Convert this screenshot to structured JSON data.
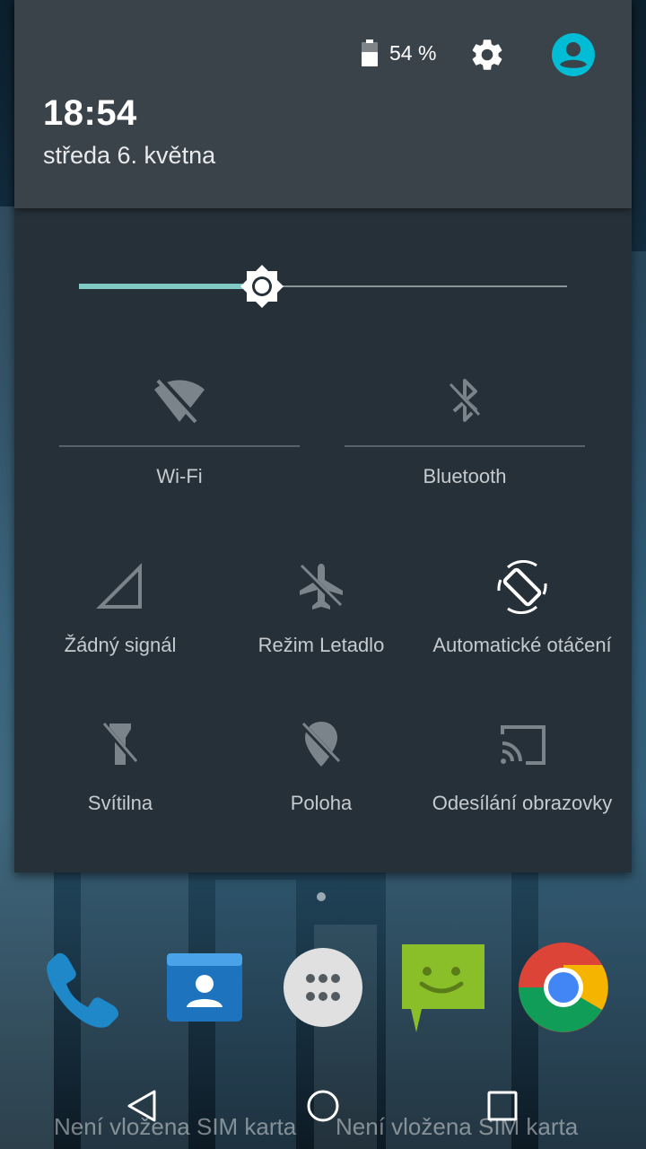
{
  "status": {
    "battery_percent": "54 %",
    "clock": "18:54",
    "date": "středa 6. května"
  },
  "brightness": {
    "level": 0.375
  },
  "tiles": {
    "wifi": {
      "label": "Wi-Fi",
      "icon": "wifi-off-icon"
    },
    "bluetooth": {
      "label": "Bluetooth",
      "icon": "bluetooth-off-icon"
    },
    "signal": {
      "label": "Žádný signál",
      "icon": "no-signal-icon"
    },
    "airplane": {
      "label": "Režim Letadlo",
      "icon": "airplane-off-icon"
    },
    "rotation": {
      "label": "Automatické otáčení",
      "icon": "auto-rotate-icon"
    },
    "flashlight": {
      "label": "Svítilna",
      "icon": "flashlight-off-icon"
    },
    "location": {
      "label": "Poloha",
      "icon": "location-off-icon"
    },
    "cast": {
      "label": "Odesílání obrazovky",
      "icon": "cast-icon"
    }
  },
  "dock": [
    "phone-icon",
    "contacts-icon",
    "app-drawer-icon",
    "messaging-icon",
    "chrome-icon"
  ],
  "sim_status": [
    "Není vložena SIM karta",
    "Není vložena SIM karta"
  ],
  "colors": {
    "accent": "#80cbc4",
    "avatar": "#00bcd4",
    "shade_bg": "#263038",
    "header_bg": "#3b434a"
  }
}
